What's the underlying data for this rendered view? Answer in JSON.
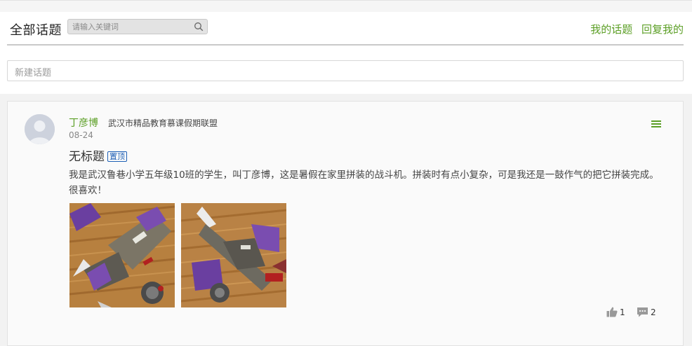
{
  "header": {
    "title": "全部话题",
    "search_placeholder": "请输入关键词",
    "link_my_topics": "我的话题",
    "link_replies": "回复我的"
  },
  "new_topic_placeholder": "新建话题",
  "post": {
    "author": "丁彦博",
    "group": "武汉市精品教育慕课假期联盟",
    "date": "08-24",
    "title": "无标题",
    "badge": "置顶",
    "body": "我是武汉鲁巷小学五年级10班的学生，叫丁彦博，这是暑假在家里拼装的战斗机。拼装时有点小复杂，可是我还是一鼓作气的把它拼装完成。很喜欢！",
    "likes": "1",
    "comments": "2"
  },
  "colors": {
    "accent_green": "#5c9f26",
    "badge_blue": "#1d5fb5"
  },
  "icons": [
    "search-icon",
    "menu-icon",
    "thumbs-up-icon",
    "comment-icon",
    "avatar-placeholder"
  ]
}
